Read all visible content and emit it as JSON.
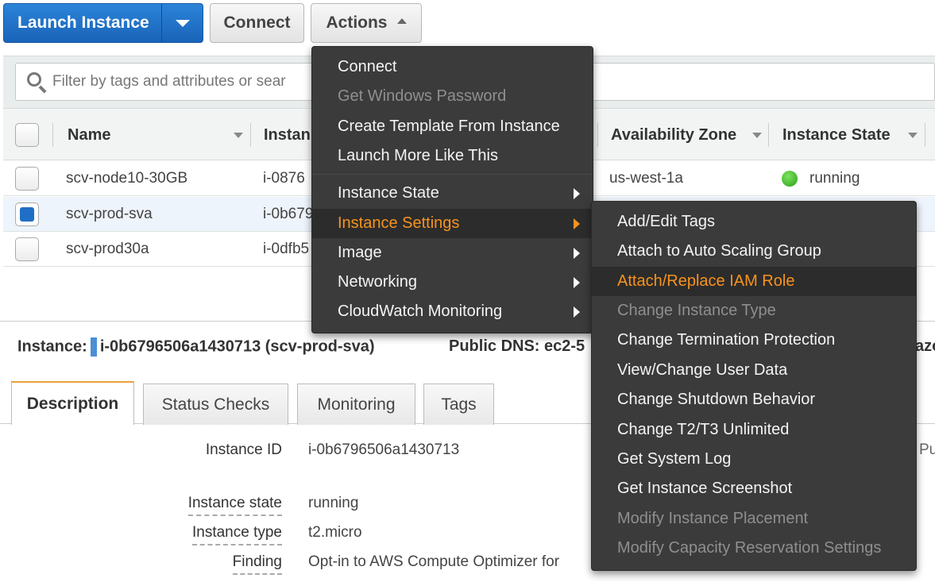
{
  "toolbar": {
    "launch_label": "Launch Instance",
    "connect_label": "Connect",
    "actions_label": "Actions"
  },
  "filter": {
    "placeholder": "Filter by tags and attributes or sear"
  },
  "table": {
    "columns": [
      "Name",
      "Instan",
      "Availability Zone",
      "Instance State"
    ],
    "rows": [
      {
        "name": "scv-node10-30GB",
        "id": "i-0876",
        "zone": "us-west-1a",
        "state": "running",
        "selected": false
      },
      {
        "name": "scv-prod-sva",
        "id": "i-0b679",
        "zone": "",
        "state": "",
        "selected": true
      },
      {
        "name": "scv-prod30a",
        "id": "i-0dfb5",
        "zone": "",
        "state": "",
        "selected": false
      }
    ]
  },
  "details": {
    "instance_label": "Instance:",
    "instance_value": "i-0b6796506a1430713 (scv-prod-sva)",
    "dns_label": "Public DNS: ec2-5",
    "dns_edge": "azo",
    "tabs": [
      "Description",
      "Status Checks",
      "Monitoring",
      "Tags"
    ],
    "fields": [
      {
        "label": "Instance ID",
        "value": "i-0b6796506a1430713"
      },
      {
        "label": "Instance state",
        "value": "running"
      },
      {
        "label": "Instance type",
        "value": "t2.micro"
      },
      {
        "label": "Finding",
        "value": "Opt-in to AWS Compute Optimizer for"
      }
    ],
    "right_edge": "Pu"
  },
  "actions_menu": {
    "items": [
      {
        "label": "Connect",
        "disabled": false
      },
      {
        "label": "Get Windows Password",
        "disabled": true
      },
      {
        "label": "Create Template From Instance",
        "disabled": false
      },
      {
        "label": "Launch More Like This",
        "disabled": false
      }
    ],
    "submenus": [
      {
        "label": "Instance State"
      },
      {
        "label": "Instance Settings"
      },
      {
        "label": "Image"
      },
      {
        "label": "Networking"
      },
      {
        "label": "CloudWatch Monitoring"
      }
    ]
  },
  "settings_menu": {
    "items": [
      {
        "label": "Add/Edit Tags",
        "disabled": false
      },
      {
        "label": "Attach to Auto Scaling Group",
        "disabled": false
      },
      {
        "label": "Attach/Replace IAM Role",
        "disabled": false
      },
      {
        "label": "Change Instance Type",
        "disabled": true
      },
      {
        "label": "Change Termination Protection",
        "disabled": false
      },
      {
        "label": "View/Change User Data",
        "disabled": false
      },
      {
        "label": "Change Shutdown Behavior",
        "disabled": false
      },
      {
        "label": "Change T2/T3 Unlimited",
        "disabled": false
      },
      {
        "label": "Get System Log",
        "disabled": false
      },
      {
        "label": "Get Instance Screenshot",
        "disabled": false
      },
      {
        "label": "Modify Instance Placement",
        "disabled": true
      },
      {
        "label": "Modify Capacity Reservation Settings",
        "disabled": true
      }
    ]
  },
  "colors": {
    "primary": "#1a63b8",
    "highlight": "#f7931e",
    "menu_bg": "#3b3b3b",
    "running": "#2e9e19"
  }
}
